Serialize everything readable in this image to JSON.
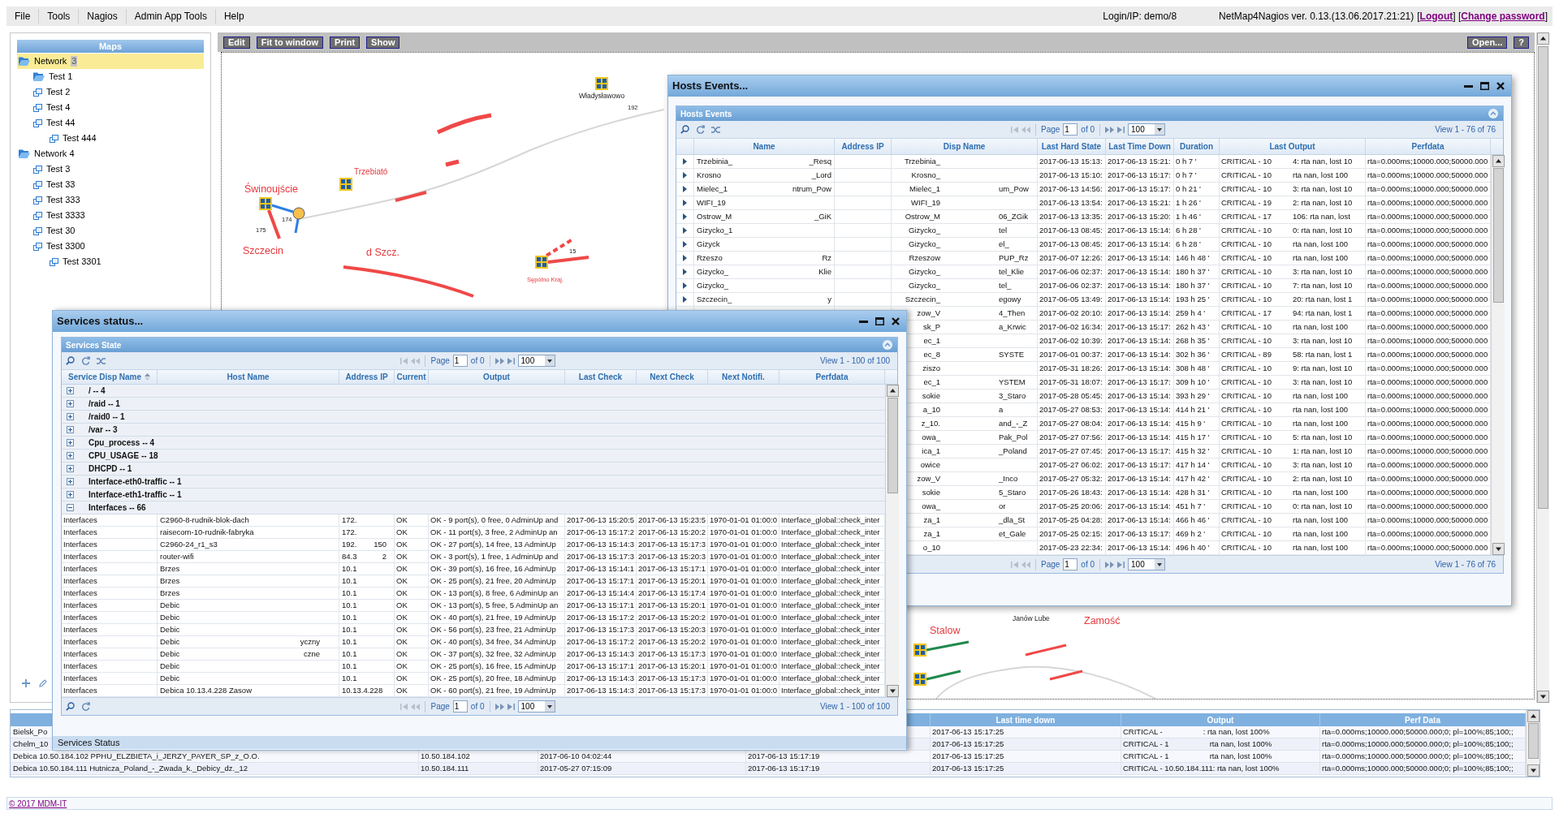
{
  "menu_bar": {
    "items": [
      "File",
      "Tools",
      "Nagios",
      "Admin App Tools",
      "Help"
    ],
    "login": "Login/IP: demo/8",
    "version": "NetMap4Nagios ver. 0.13.(13.06.2017.21:21)",
    "links": [
      {
        "prefix": "[",
        "label": "Logout",
        "suffix": "]"
      },
      {
        "prefix": "[",
        "label": "Change password",
        "suffix": "]"
      }
    ]
  },
  "maps_panel": {
    "title": "Maps",
    "tree": [
      {
        "label": "Network",
        "badge": "3",
        "kind": "folder",
        "selected": true,
        "children": [
          {
            "label": "Test 1",
            "kind": "folder",
            "selected": false
          },
          {
            "label": "Test 2",
            "kind": "map",
            "selected": false
          },
          {
            "label": "Test 4",
            "kind": "map",
            "selected": false
          },
          {
            "label": "Test 44",
            "kind": "map",
            "selected": false,
            "children": [
              {
                "label": "Test 444",
                "kind": "map",
                "selected": false
              }
            ]
          }
        ]
      },
      {
        "label": "Network 4",
        "kind": "folder",
        "selected": false,
        "children": [
          {
            "label": "Test 3",
            "kind": "map",
            "selected": false
          },
          {
            "label": "Test 33",
            "kind": "map",
            "selected": false
          },
          {
            "label": "Test 333",
            "kind": "map",
            "selected": false
          },
          {
            "label": "Test 3333",
            "kind": "map",
            "selected": false
          },
          {
            "label": "Test 30",
            "kind": "map",
            "selected": false
          },
          {
            "label": "Test 3300",
            "kind": "map",
            "selected": false,
            "children": [
              {
                "label": "Test 3301",
                "kind": "map",
                "selected": false
              }
            ]
          }
        ]
      }
    ]
  },
  "map_toolbar": {
    "buttons": [
      "Edit",
      "Fit to window",
      "Print",
      "Show"
    ],
    "right_buttons": [
      "Open...",
      "?"
    ]
  },
  "map": {
    "labels": [
      {
        "text": "Władysławowo",
        "kind": "place"
      },
      {
        "text": "192",
        "kind": "number"
      },
      {
        "text": "Trzebiató",
        "kind": "town"
      },
      {
        "text": "Świnoujście",
        "kind": "city"
      },
      {
        "text": "174",
        "kind": "number"
      },
      {
        "text": "175",
        "kind": "number"
      },
      {
        "text": "Szczecin",
        "kind": "city"
      },
      {
        "text": "d Szcz.",
        "kind": "city"
      },
      {
        "text": "Sępólno Kraj.",
        "kind": "village"
      },
      {
        "text": "15",
        "kind": "number"
      },
      {
        "text": "Stalow",
        "kind": "city"
      },
      {
        "text": "Janów Lube",
        "kind": "place"
      },
      {
        "text": "Zamość",
        "kind": "city"
      }
    ]
  },
  "hosts_window": {
    "title": "Hosts Events...",
    "panel_title": "Hosts Events",
    "top_pager": {
      "page_label": "Page",
      "page": "1",
      "page_count": "of 0",
      "page_size": "100",
      "view": "View 1 - 76 of 76"
    },
    "columns": [
      "Name",
      "Address IP",
      "Disp Name",
      "Last Hard State",
      "Last Time Down",
      "Duration",
      "Last Output",
      "Perfdata"
    ],
    "rows": [
      {
        "name_start": "Trzebinia_",
        "name_end": "_Resq",
        "disp_start": "Trzebinia_",
        "last_hard_state": "2017-06-13 15:13:",
        "last_time_down": "2017-06-13 15:21:",
        "duration": "0 h 7 '",
        "output_start": "CRITICAL - 10",
        "output_end": "4: rta nan, lost 10",
        "perfdata": "rta=0.000ms;10000.000;50000.000"
      },
      {
        "name_start": "Krosno",
        "name_end": "_Lord",
        "disp_start": "Krosno_",
        "last_hard_state": "2017-06-13 15:10:",
        "last_time_down": "2017-06-13 15:17:",
        "duration": "0 h 7 '",
        "output_start": "CRITICAL - 10",
        "output_end": "rta nan, lost 100",
        "perfdata": "rta=0.000ms;10000.000;50000.000"
      },
      {
        "name_start": "Mielec_1",
        "name_end": "ntrum_Pow",
        "disp_start": "Mielec_1",
        "disp_end": "um_Pow",
        "last_hard_state": "2017-06-13 14:56:",
        "last_time_down": "2017-06-13 15:17:",
        "duration": "0 h 21 '",
        "output_start": "CRITICAL - 10",
        "output_end": "3: rta nan, lost 10",
        "perfdata": "rta=0.000ms;10000.000;50000.000"
      },
      {
        "name_start": "WIFI_19",
        "disp_start": "WIFI_19",
        "last_hard_state": "2017-06-13 13:54:",
        "last_time_down": "2017-06-13 15:21:",
        "duration": "1 h 26 '",
        "output_start": "CRITICAL - 19",
        "output_end": "2: rta nan, lost 10",
        "perfdata": "rta=0.000ms;10000.000;50000.000"
      },
      {
        "name_start": "Ostrow_M",
        "name_end": "_GiK",
        "disp_start": "Ostrow_M",
        "disp_end": "06_ZGik",
        "last_hard_state": "2017-06-13 13:35:",
        "last_time_down": "2017-06-13 15:20:",
        "duration": "1 h 46 '",
        "output_start": "CRITICAL - 17",
        "output_end": "106: rta nan, lost",
        "perfdata": "rta=0.000ms;10000.000;50000.000"
      },
      {
        "name_start": "Gizycko_1",
        "disp_start": "Gizycko_",
        "disp_end": "tel",
        "last_hard_state": "2017-06-13 08:45:",
        "last_time_down": "2017-06-13 15:14:",
        "duration": "6 h 28 '",
        "output_start": "CRITICAL - 10",
        "output_end": "0: rta nan, lost 10",
        "perfdata": "rta=0.000ms;10000.000;50000.000"
      },
      {
        "name_start": "Gizyck",
        "disp_start": "Gizycko_",
        "disp_end": "el_",
        "last_hard_state": "2017-06-13 08:45:",
        "last_time_down": "2017-06-13 15:14:",
        "duration": "6 h 28 '",
        "output_start": "CRITICAL - 10",
        "output_end": "rta nan, lost 100",
        "perfdata": "rta=0.000ms;10000.000;50000.000"
      },
      {
        "name_start": "Rzeszo",
        "name_end": "Rz",
        "disp_start": "Rzeszow",
        "disp_end": "PUP_Rz",
        "last_hard_state": "2017-06-07 12:26:",
        "last_time_down": "2017-06-13 15:14:",
        "duration": "146 h 48 '",
        "output_start": "CRITICAL - 10",
        "output_end": "rta nan, lost 100",
        "perfdata": "rta=0.000ms;10000.000;50000.000"
      },
      {
        "name_start": "Gizycko_",
        "name_end": "Klie",
        "disp_start": "Gizycko_",
        "disp_end": "tel_Klie",
        "last_hard_state": "2017-06-06 02:37:",
        "last_time_down": "2017-06-13 15:14:",
        "duration": "180 h 37 '",
        "output_start": "CRITICAL - 10",
        "output_end": "3: rta nan, lost 10",
        "perfdata": "rta=0.000ms;10000.000;50000.000"
      },
      {
        "name_start": "Gizycko_",
        "disp_start": "Gizycko_",
        "disp_end": "tel_",
        "last_hard_state": "2017-06-06 02:37:",
        "last_time_down": "2017-06-13 15:14:",
        "duration": "180 h 37 '",
        "output_start": "CRITICAL - 10",
        "output_end": "7: rta nan, lost 10",
        "perfdata": "rta=0.000ms;10000.000;50000.000"
      },
      {
        "name_start": "Szczecin_",
        "name_end": "y",
        "disp_start": "Szczecin_",
        "disp_end": "egowy",
        "last_hard_state": "2017-06-05 13:49:",
        "last_time_down": "2017-06-13 15:14:",
        "duration": "193 h 25 '",
        "output_start": "CRITICAL - 10",
        "output_end": "20: rta nan, lost 1",
        "perfdata": "rta=0.000ms;10000.000;50000.000"
      },
      {
        "disp_start": "zow_V",
        "disp_end": "4_Then",
        "last_hard_state": "2017-06-02 20:10:",
        "last_time_down": "2017-06-13 15:14:",
        "duration": "259 h 4 '",
        "output_start": "CRITICAL - 17",
        "output_end": "94: rta nan, lost 1",
        "perfdata": "rta=0.000ms;10000.000;50000.000"
      },
      {
        "disp_start": "sk_P",
        "disp_end": "a_Krwic",
        "last_hard_state": "2017-06-02 16:34:",
        "last_time_down": "2017-06-13 15:17:",
        "duration": "262 h 43 '",
        "output_start": "CRITICAL - 10",
        "output_end": "rta nan, lost 100",
        "perfdata": "rta=0.000ms;10000.000;50000.000"
      },
      {
        "disp_start": "ec_1",
        "last_hard_state": "2017-06-02 10:39:",
        "last_time_down": "2017-06-13 15:14:",
        "duration": "268 h 35 '",
        "output_start": "CRITICAL - 10",
        "output_end": "3: rta nan, lost 10",
        "perfdata": "rta=0.000ms;10000.000;50000.000"
      },
      {
        "disp_start": "ec_8",
        "disp_end": "SYSTE",
        "last_hard_state": "2017-06-01 00:37:",
        "last_time_down": "2017-06-13 15:14:",
        "duration": "302 h 36 '",
        "output_start": "CRITICAL - 89",
        "output_end": "58: rta nan, lost 1",
        "perfdata": "rta=0.000ms;10000.000;50000.000"
      },
      {
        "disp_start": "ziszo",
        "last_hard_state": "2017-05-31 18:26:",
        "last_time_down": "2017-06-13 15:14:",
        "duration": "308 h 48 '",
        "output_start": "CRITICAL - 10",
        "output_end": "9: rta nan, lost 10",
        "perfdata": "rta=0.000ms;10000.000;50000.000"
      },
      {
        "disp_start": "ec_1",
        "disp_end": "YSTEM",
        "last_hard_state": "2017-05-31 18:07:",
        "last_time_down": "2017-06-13 15:17:",
        "duration": "309 h 10 '",
        "output_start": "CRITICAL - 10",
        "output_end": "3: rta nan, lost 10",
        "perfdata": "rta=0.000ms;10000.000;50000.000"
      },
      {
        "disp_start": "sokie",
        "disp_end": "3_Staro",
        "last_hard_state": "2017-05-28 05:45:",
        "last_time_down": "2017-06-13 15:14:",
        "duration": "393 h 29 '",
        "output_start": "CRITICAL - 10",
        "output_end": "rta nan, lost 100",
        "perfdata": "rta=0.000ms;10000.000;50000.000"
      },
      {
        "disp_start": "a_10",
        "disp_end": "a",
        "last_hard_state": "2017-05-27 08:53:",
        "last_time_down": "2017-06-13 15:14:",
        "duration": "414 h 21 '",
        "output_start": "CRITICAL - 10",
        "output_end": "rta nan, lost 100",
        "perfdata": "rta=0.000ms;10000.000;50000.000"
      },
      {
        "disp_start": "z_10.",
        "disp_end": "and_-_Z",
        "last_hard_state": "2017-05-27 08:04:",
        "last_time_down": "2017-06-13 15:14:",
        "duration": "415 h 9 '",
        "output_start": "CRITICAL - 10",
        "output_end": "rta nan, lost 100",
        "perfdata": "rta=0.000ms;10000.000;50000.000"
      },
      {
        "disp_start": "owa_",
        "disp_end": "Pak_Pol",
        "last_hard_state": "2017-05-27 07:56:",
        "last_time_down": "2017-06-13 15:14:",
        "duration": "415 h 17 '",
        "output_start": "CRITICAL - 10",
        "output_end": "5: rta nan, lost 10",
        "perfdata": "rta=0.000ms;10000.000;50000.000"
      },
      {
        "disp_start": "ica_1",
        "disp_end": "_Poland",
        "last_hard_state": "2017-05-27 07:45:",
        "last_time_down": "2017-06-13 15:17:",
        "duration": "415 h 32 '",
        "output_start": "CRITICAL - 10",
        "output_end": "1: rta nan, lost 10",
        "perfdata": "rta=0.000ms;10000.000;50000.000"
      },
      {
        "disp_start": "owice",
        "last_hard_state": "2017-05-27 06:02:",
        "last_time_down": "2017-06-13 15:17:",
        "duration": "417 h 14 '",
        "output_start": "CRITICAL - 10",
        "output_end": "3: rta nan, lost 10",
        "perfdata": "rta=0.000ms;10000.000;50000.000"
      },
      {
        "disp_start": "zow_V",
        "disp_end": "_Inco",
        "last_hard_state": "2017-05-27 05:32:",
        "last_time_down": "2017-06-13 15:14:",
        "duration": "417 h 42 '",
        "output_start": "CRITICAL - 10",
        "output_end": "2: rta nan, lost 10",
        "perfdata": "rta=0.000ms;10000.000;50000.000"
      },
      {
        "disp_start": "sokie",
        "disp_end": "5_Staro",
        "last_hard_state": "2017-05-26 18:43:",
        "last_time_down": "2017-06-13 15:14:",
        "duration": "428 h 31 '",
        "output_start": "CRITICAL - 10",
        "output_end": "rta nan, lost 100",
        "perfdata": "rta=0.000ms;10000.000;50000.000"
      },
      {
        "disp_start": "owa_",
        "disp_end": "or",
        "last_hard_state": "2017-05-25 20:06:",
        "last_time_down": "2017-06-13 15:14:",
        "duration": "451 h 7 '",
        "output_start": "CRITICAL - 10",
        "output_end": "0: rta nan, lost 10",
        "perfdata": "rta=0.000ms;10000.000;50000.000"
      },
      {
        "disp_start": "za_1",
        "disp_end": "_dla_St",
        "last_hard_state": "2017-05-25 04:28:",
        "last_time_down": "2017-06-13 15:14:",
        "duration": "466 h 46 '",
        "output_start": "CRITICAL - 10",
        "output_end": "rta nan, lost 100",
        "perfdata": "rta=0.000ms;10000.000;50000.000"
      },
      {
        "disp_start": "za_1",
        "disp_end": "et_Gale",
        "last_hard_state": "2017-05-25 02:15:",
        "last_time_down": "2017-06-13 15:17:",
        "duration": "469 h 2 '",
        "output_start": "CRITICAL - 10",
        "output_end": "rta nan, lost 100",
        "perfdata": "rta=0.000ms;10000.000;50000.000"
      },
      {
        "disp_start": "o_10",
        "last_hard_state": "2017-05-23 22:34:",
        "last_time_down": "2017-06-13 15:14:",
        "duration": "496 h 40 '",
        "output_start": "CRITICAL - 10",
        "output_end": "rta nan, lost 100",
        "perfdata": "rta=0.000ms;10000.000;50000.000"
      }
    ],
    "bottom_pager": {
      "page_label": "Page",
      "page": "1",
      "page_count": "of 0",
      "page_size": "100",
      "view": "View 1 - 76 of 76"
    }
  },
  "services_window": {
    "title": "Services status...",
    "panel_title": "Services State",
    "top_pager": {
      "page_label": "Page",
      "page": "1",
      "page_count": "of 0",
      "page_size": "100",
      "view": "View 1 - 100 of 100"
    },
    "columns": [
      {
        "label": "Service Disp Name",
        "sorted": true
      },
      {
        "label": "Host Name",
        "sorted": false
      },
      {
        "label": "Address IP",
        "sorted": false
      },
      {
        "label": "Current",
        "sorted": false
      },
      {
        "label": "Output",
        "sorted": false
      },
      {
        "label": "Last Check",
        "sorted": false
      },
      {
        "label": "Next Check",
        "sorted": false
      },
      {
        "label": "Next Notifi.",
        "sorted": false
      },
      {
        "label": "Perfdata",
        "sorted": false
      }
    ],
    "groups": [
      {
        "label": "/ -- 4",
        "expanded": false
      },
      {
        "label": "/raid -- 1",
        "expanded": false
      },
      {
        "label": "/raid0 -- 1",
        "expanded": false
      },
      {
        "label": "/var -- 3",
        "expanded": false
      },
      {
        "label": "Cpu_process -- 4",
        "expanded": false
      },
      {
        "label": "CPU_USAGE -- 18",
        "expanded": false
      },
      {
        "label": "DHCPD -- 1",
        "expanded": false
      },
      {
        "label": "Interface-eth0-traffic -- 1",
        "expanded": false
      },
      {
        "label": "Interface-eth1-traffic -- 1",
        "expanded": false
      },
      {
        "label": "Interfaces -- 66",
        "expanded": true,
        "rows": [
          {
            "service": "Interfaces",
            "host_start": "C2960-8-rudnik-blok-dach",
            "address_start": "172.",
            "current": "OK",
            "output": "OK - 9 port(s), 0 free, 0 AdminUp and",
            "last_check": "2017-06-13 15:20:5",
            "next_check": "2017-06-13 15:23:5",
            "next_notification": "1970-01-01 01:00:0",
            "perfdata": "Interface_global::check_inter"
          },
          {
            "service": "Interfaces",
            "host_start": "raisecom-10-rudnik-fabryka",
            "address_start": "172.",
            "current": "OK",
            "output": "OK - 11 port(s), 3 free, 2 AdminUp an",
            "last_check": "2017-06-13 15:17:2",
            "next_check": "2017-06-13 15:20:2",
            "next_notification": "1970-01-01 01:00:0",
            "perfdata": "Interface_global::check_inter"
          },
          {
            "service": "Interfaces",
            "host_start": "C2960-24_r1_s3",
            "address_start": "192.",
            "address_end": "150",
            "current": "OK",
            "output": "OK - 27 port(s), 14 free, 13 AdminUp",
            "last_check": "2017-06-13 15:14:3",
            "next_check": "2017-06-13 15:17:3",
            "next_notification": "1970-01-01 01:00:0",
            "perfdata": "Interface_global::check_inter"
          },
          {
            "service": "Interfaces",
            "host_start": "router-wifi",
            "address_start": "84.3",
            "address_end": "2",
            "current": "OK",
            "output": "OK - 3 port(s), 1 free, 1 AdminUp and",
            "last_check": "2017-06-13 15:17:3",
            "next_check": "2017-06-13 15:20:3",
            "next_notification": "1970-01-01 01:00:0",
            "perfdata": "Interface_global::check_inter"
          },
          {
            "service": "Interfaces",
            "host_start": "Brzes",
            "address_start": "10.1",
            "current": "OK",
            "output": "OK - 39 port(s), 16 free, 16 AdminUp",
            "last_check": "2017-06-13 15:14:1",
            "next_check": "2017-06-13 15:17:1",
            "next_notification": "1970-01-01 01:00:0",
            "perfdata": "Interface_global::check_inter"
          },
          {
            "service": "Interfaces",
            "host_start": "Brzes",
            "address_start": "10.1",
            "current": "OK",
            "output": "OK - 25 port(s), 21 free, 20 AdminUp",
            "last_check": "2017-06-13 15:17:1",
            "next_check": "2017-06-13 15:20:1",
            "next_notification": "1970-01-01 01:00:0",
            "perfdata": "Interface_global::check_inter"
          },
          {
            "service": "Interfaces",
            "host_start": "Brzes",
            "address_start": "10.1",
            "current": "OK",
            "output": "OK - 13 port(s), 8 free, 6 AdminUp an",
            "last_check": "2017-06-13 15:14:4",
            "next_check": "2017-06-13 15:17:4",
            "next_notification": "1970-01-01 01:00:0",
            "perfdata": "Interface_global::check_inter"
          },
          {
            "service": "Interfaces",
            "host_start": "Debic",
            "address_start": "10.1",
            "current": "OK",
            "output": "OK - 13 port(s), 5 free, 5 AdminUp an",
            "last_check": "2017-06-13 15:17:1",
            "next_check": "2017-06-13 15:20:1",
            "next_notification": "1970-01-01 01:00:0",
            "perfdata": "Interface_global::check_inter"
          },
          {
            "service": "Interfaces",
            "host_start": "Debic",
            "address_start": "10.1",
            "current": "OK",
            "output": "OK - 40 port(s), 21 free, 19 AdminUp",
            "last_check": "2017-06-13 15:17:2",
            "next_check": "2017-06-13 15:20:2",
            "next_notification": "1970-01-01 01:00:0",
            "perfdata": "Interface_global::check_inter"
          },
          {
            "service": "Interfaces",
            "host_start": "Debic",
            "address_start": "10.1",
            "current": "OK",
            "output": "OK - 56 port(s), 23 free, 21 AdminUp",
            "last_check": "2017-06-13 15:17:3",
            "next_check": "2017-06-13 15:20:3",
            "next_notification": "1970-01-01 01:00:0",
            "perfdata": "Interface_global::check_inter"
          },
          {
            "service": "Interfaces",
            "host_start": "Debic",
            "host_end": "yczny",
            "address_start": "10.1",
            "current": "OK",
            "output": "OK - 40 port(s), 34 free, 34 AdminUp",
            "last_check": "2017-06-13 15:17:2",
            "next_check": "2017-06-13 15:20:2",
            "next_notification": "1970-01-01 01:00:0",
            "perfdata": "Interface_global::check_inter"
          },
          {
            "service": "Interfaces",
            "host_start": "Debic",
            "host_end": "czne",
            "address_start": "10.1",
            "current": "OK",
            "output": "OK - 37 port(s), 32 free, 32 AdminUp",
            "last_check": "2017-06-13 15:14:3",
            "next_check": "2017-06-13 15:17:3",
            "next_notification": "1970-01-01 01:00:0",
            "perfdata": "Interface_global::check_inter"
          },
          {
            "service": "Interfaces",
            "host_start": "Debic",
            "address_start": "10.1",
            "current": "OK",
            "output": "OK - 25 port(s), 16 free, 15 AdminUp",
            "last_check": "2017-06-13 15:17:1",
            "next_check": "2017-06-13 15:20:1",
            "next_notification": "1970-01-01 01:00:0",
            "perfdata": "Interface_global::check_inter"
          },
          {
            "service": "Interfaces",
            "host_start": "Debic",
            "address_start": "10.1",
            "current": "OK",
            "output": "OK - 25 port(s), 20 free, 18 AdminUp",
            "last_check": "2017-06-13 15:14:3",
            "next_check": "2017-06-13 15:17:3",
            "next_notification": "1970-01-01 01:00:0",
            "perfdata": "Interface_global::check_inter"
          },
          {
            "service": "Interfaces",
            "host_start": "Debica 10.13.4.228 Zasow",
            "address_start": "10.13.4.228",
            "current": "OK",
            "output": "OK - 60 port(s), 21 free, 19 AdminUp",
            "last_check": "2017-06-13 15:14:3",
            "next_check": "2017-06-13 15:17:3",
            "next_notification": "1970-01-01 01:00:0",
            "perfdata": "Interface_global::check_inter"
          }
        ]
      }
    ],
    "bottom_pager": {
      "page_label": "Page",
      "page": "1",
      "page_count": "of 0",
      "page_size": "100",
      "view": "View 1 - 100 of 100"
    },
    "footer": "Services Status"
  },
  "status_panel": {
    "columns": [
      "Last time down",
      "Output",
      "Perf Data"
    ],
    "rows": [
      {
        "column_1": "Bielsk_Po",
        "last_time_down": "2017-06-13 15:17:25",
        "output_start": "CRITICAL -",
        "output_end": ": rta nan, lost 100%",
        "perf_data": "rta=0.000ms;10000.000;50000.000;0; pl=100%;85;100;;"
      },
      {
        "column_1": "Chelm_10",
        "last_time_down": "2017-06-13 15:17:25",
        "output_start": "CRITICAL - 1",
        "output_end": "rta nan, lost 100%",
        "perf_data": "rta=0.000ms;10000.000;50000.000;0; pl=100%;85;100;;"
      },
      {
        "column_1": "Debica 10.50.184.102 PPHU_ELZBIETA_i_JERZY_PAYER_SP_z_O.O.",
        "column_2": "10.50.184.102",
        "column_3": "2017-06-10 04:02:44",
        "column_4": "2017-06-13 15:17:19",
        "last_time_down": "2017-06-13 15:17:25",
        "output_start": "CRITICAL - 1",
        "output_end": "rta nan, lost 100%",
        "perf_data": "rta=0.000ms;10000.000;50000.000;0; pl=100%;85;100;;"
      },
      {
        "column_1": "Debica 10.50.184.111 Hutnicza_Poland_-_Zwada_k._Debicy_dz._12",
        "column_2": "10.50.184.111",
        "column_3": "2017-05-27 07:15:09",
        "column_4": "2017-06-13 15:17:19",
        "last_time_down": "2017-06-13 15:17:25",
        "output_start": "CRITICAL - 10.50.184.111: rta nan, lost 100%",
        "perf_data": "rta=0.000ms;10000.000;50000.000;0; pl=100%;85;100;;"
      }
    ]
  },
  "footer": {
    "copyright": "© 2017 MDM-IT"
  }
}
